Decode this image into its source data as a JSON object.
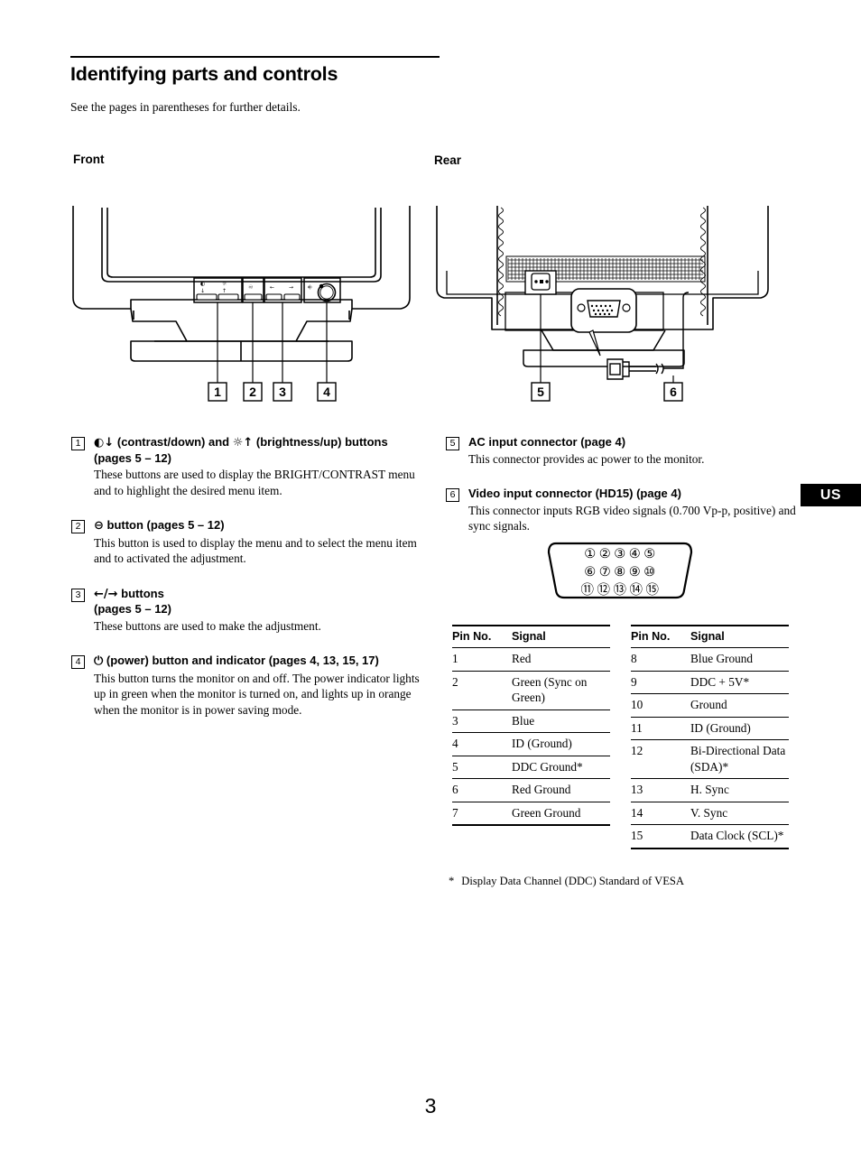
{
  "document": {
    "title": "Identifying parts and controls",
    "subtitle": "See the pages in parentheses for further details.",
    "page_number": "3",
    "region_tab": "US"
  },
  "sections": {
    "front_heading": "Front",
    "rear_heading": "Rear"
  },
  "front_callouts": [
    "1",
    "2",
    "3",
    "4"
  ],
  "rear_callouts": [
    "5",
    "6"
  ],
  "front_items": [
    {
      "num": "1",
      "heading_pre": "",
      "glyph1": "◐↓",
      "heading_mid": " (contrast/down) and ",
      "glyph2": "☼↑",
      "heading_post": " (brightness/up) buttons (pages 5 – 12)",
      "body": "These buttons are used to display the BRIGHT/CONTRAST menu and to highlight the desired menu item."
    },
    {
      "num": "2",
      "glyph1": "⊖",
      "heading_post": " button (pages 5 – 12)",
      "body": "This button is used to display the menu and to select the menu item and to activated the adjustment."
    },
    {
      "num": "3",
      "glyph1": "←/→",
      "heading_post": " buttons",
      "heading_line2": "(pages 5 – 12)",
      "body": "These buttons are used to make the adjustment."
    },
    {
      "num": "4",
      "glyph1": "⏻",
      "heading_post": " (power) button and indicator (pages 4, 13, 15, 17)",
      "body": "This button turns the monitor on and off. The power indicator lights up in green when the monitor is turned on, and lights up in orange when the monitor is in power saving mode."
    }
  ],
  "rear_items": [
    {
      "num": "5",
      "heading": "AC input connector (page 4)",
      "body": "This connector provides ac power to the monitor."
    },
    {
      "num": "6",
      "heading": "Video input connector (HD15) (page 4)",
      "body": "This connector inputs RGB video signals (0.700 Vp-p, positive) and sync signals."
    }
  ],
  "pin_diagram": {
    "row1": [
      "①",
      "②",
      "③",
      "④",
      "⑤"
    ],
    "row2": [
      "⑥",
      "⑦",
      "⑧",
      "⑨",
      "⑩"
    ],
    "row3": [
      "⑪",
      "⑫",
      "⑬",
      "⑭",
      "⑮"
    ]
  },
  "pin_table_left": {
    "headers": [
      "Pin No.",
      "Signal"
    ],
    "rows": [
      {
        "no": "1",
        "signal": "Red"
      },
      {
        "no": "2",
        "signal": "Green (Sync on Green)"
      },
      {
        "no": "3",
        "signal": "Blue"
      },
      {
        "no": "4",
        "signal": "ID (Ground)"
      },
      {
        "no": "5",
        "signal": "DDC Ground*"
      },
      {
        "no": "6",
        "signal": "Red Ground"
      },
      {
        "no": "7",
        "signal": "Green Ground"
      }
    ]
  },
  "pin_table_right": {
    "headers": [
      "Pin No.",
      "Signal"
    ],
    "rows": [
      {
        "no": "8",
        "signal": "Blue Ground"
      },
      {
        "no": "9",
        "signal": "DDC + 5V*"
      },
      {
        "no": "10",
        "signal": "Ground"
      },
      {
        "no": "11",
        "signal": "ID (Ground)"
      },
      {
        "no": "12",
        "signal": "Bi-Directional Data (SDA)*"
      },
      {
        "no": "13",
        "signal": "H. Sync"
      },
      {
        "no": "14",
        "signal": "V. Sync"
      },
      {
        "no": "15",
        "signal": "Data Clock (SCL)*"
      }
    ]
  },
  "footnote": {
    "marker": "*",
    "text": "Display Data Channel (DDC) Standard of VESA"
  }
}
